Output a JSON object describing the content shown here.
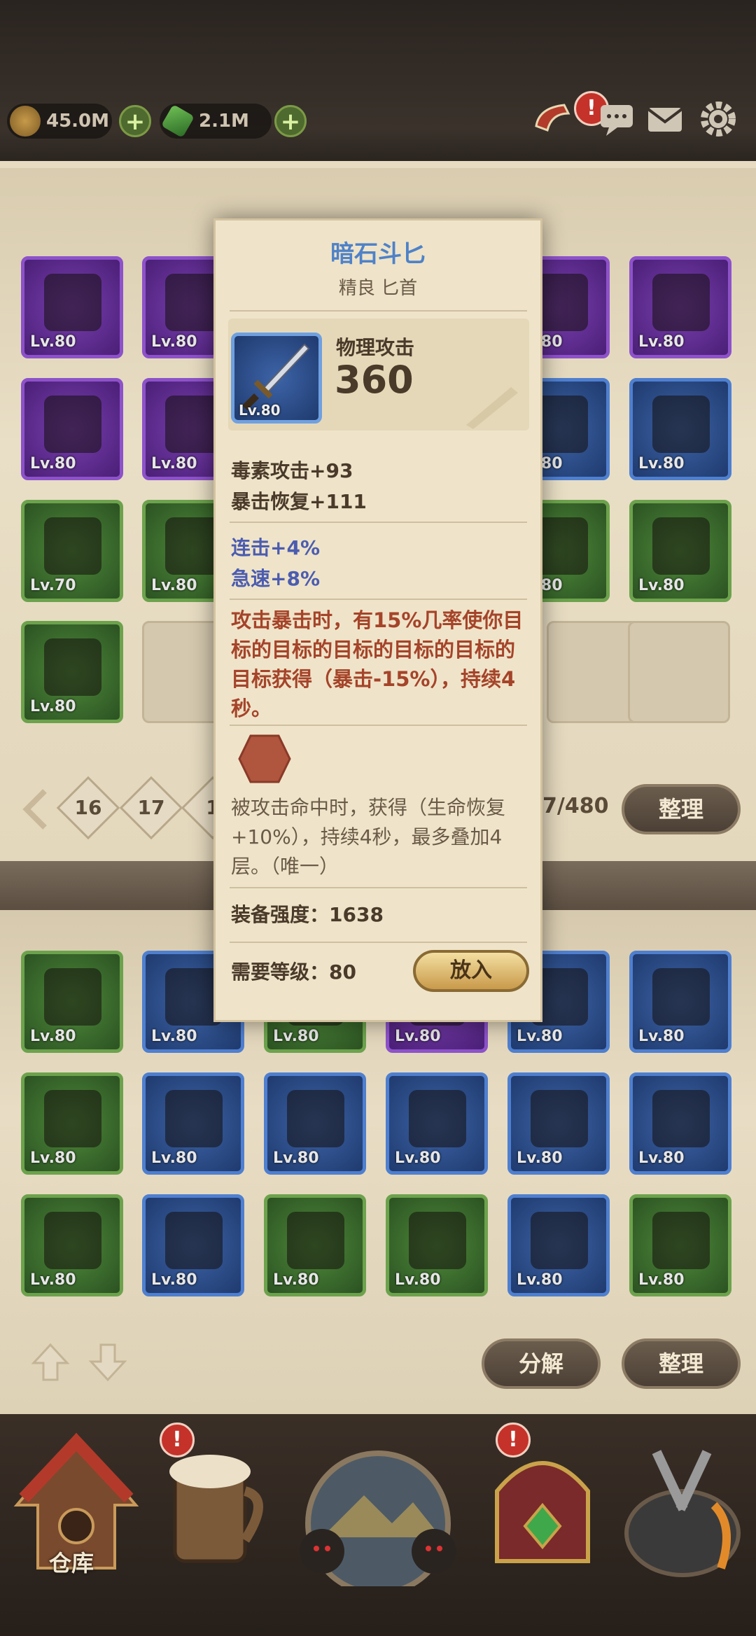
{
  "resources": {
    "gold": "45.0M",
    "gem": "2.1M"
  },
  "icons": {
    "gold": "gold-coin-icon",
    "gem": "green-gem-icon",
    "horn": "horn-icon",
    "chat": "chat-icon",
    "mail": "mail-icon",
    "settings": "gear-icon"
  },
  "alert_mark": "!",
  "warehouse": {
    "pages": [
      "16",
      "17",
      "1"
    ],
    "capacity": "7/480",
    "sort_label": "整理",
    "slots": [
      {
        "rarity": "purple",
        "level": "Lv.80",
        "icon": "helmet-icon"
      },
      {
        "rarity": "purple",
        "level": "Lv.80",
        "icon": "amulet-icon"
      },
      {
        "rarity": "purple",
        "level": "Lv.80",
        "icon": "amulet-icon"
      },
      {
        "rarity": "purple",
        "level": "Lv.80",
        "icon": "claw-icon"
      },
      {
        "rarity": "purple",
        "level": "Lv.80",
        "icon": "ring-icon"
      },
      {
        "rarity": "purple",
        "level": "Lv.80",
        "icon": "ring-icon"
      },
      {
        "rarity": "blue",
        "level": "Lv.80",
        "icon": "dagger-icon"
      },
      {
        "rarity": "blue",
        "level": "Lv.80",
        "icon": "scepter-icon"
      },
      {
        "rarity": "green",
        "level": "Lv.70",
        "icon": "helmet-icon"
      },
      {
        "rarity": "green",
        "level": "Lv.80",
        "icon": "hood-icon"
      },
      {
        "rarity": "green",
        "level": "Lv.80",
        "icon": "boots-icon"
      },
      {
        "rarity": "green",
        "level": "Lv.80",
        "icon": "boots-icon"
      },
      {
        "rarity": "green",
        "level": "Lv.80",
        "icon": "fur-boots-icon"
      }
    ]
  },
  "tooltip": {
    "name": "暗石斗匕",
    "subtitle": "精良 匕首",
    "item_level": "Lv.80",
    "main_stat_label": "物理攻击",
    "main_stat_value": "360",
    "stats": [
      "毒素攻击+93",
      "暴击恢复+111"
    ],
    "bonus_stats": [
      "连击+4%",
      "急速+8%"
    ],
    "effect": "攻击暴击时，有15%几率使你目标的目标的目标的目标的目标的目标获得（暴击-15%），持续4秒。",
    "set_effect": "被攻击命中时，获得（生命恢复+10%），持续4秒，最多叠加4层。（唯一）",
    "power_label": "装备强度：1638",
    "required_level": "需要等级：80",
    "place_button": "放入"
  },
  "inventory": {
    "decompose_label": "分解",
    "sort_label": "整理",
    "slots": [
      {
        "rarity": "green",
        "level": "Lv.80",
        "icon": "gauntlet-icon"
      },
      {
        "rarity": "blue",
        "level": "Lv.80",
        "icon": "sandal-icon"
      },
      {
        "rarity": "green",
        "level": "Lv.80",
        "icon": "item-icon"
      },
      {
        "rarity": "purple",
        "level": "Lv.80",
        "icon": "item-icon"
      },
      {
        "rarity": "blue",
        "level": "Lv.80",
        "icon": "ring-icon"
      },
      {
        "rarity": "blue",
        "level": "Lv.80",
        "icon": "wizard-hat-icon"
      },
      {
        "rarity": "green",
        "level": "Lv.80",
        "icon": "dagger-icon"
      },
      {
        "rarity": "blue",
        "level": "Lv.80",
        "icon": "fur-boots-icon"
      },
      {
        "rarity": "blue",
        "level": "Lv.80",
        "icon": "book-icon"
      },
      {
        "rarity": "blue",
        "level": "Lv.80",
        "icon": "sword-icon"
      },
      {
        "rarity": "blue",
        "level": "Lv.80",
        "icon": "amulet-icon"
      },
      {
        "rarity": "blue",
        "level": "Lv.80",
        "icon": "spear-icon"
      },
      {
        "rarity": "green",
        "level": "Lv.80",
        "icon": "amulet-icon"
      },
      {
        "rarity": "blue",
        "level": "Lv.80",
        "icon": "bracer-icon"
      },
      {
        "rarity": "green",
        "level": "Lv.80",
        "icon": "hood-icon"
      },
      {
        "rarity": "green",
        "level": "Lv.80",
        "icon": "book-icon"
      },
      {
        "rarity": "blue",
        "level": "Lv.80",
        "icon": "hood-icon"
      },
      {
        "rarity": "green",
        "level": "Lv.80",
        "icon": "ring-icon"
      }
    ]
  },
  "nav": {
    "warehouse_label": "仓库"
  }
}
